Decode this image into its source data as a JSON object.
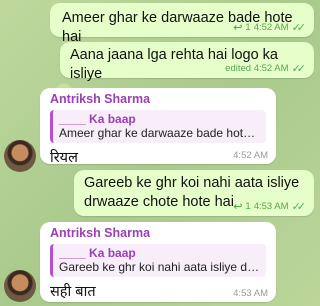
{
  "messages": [
    {
      "type": "out",
      "text": "Ameer ghar ke darwaaze bade hote hai",
      "reply_count": "1",
      "time": "4:52 AM"
    },
    {
      "type": "out",
      "text": "Aana jaana lga rehta hai logo ka isliye",
      "time": "edited 4:52 AM"
    },
    {
      "type": "in",
      "sender": "Antriksh Sharma",
      "quote_author": "____ Ka baap",
      "quote_text": "Ameer ghar ke darwaaze bade hote hai",
      "text": "रियल",
      "time": "4:52 AM"
    },
    {
      "type": "out",
      "text_line1": "Gareeb ke ghr koi nahi aata isliye",
      "text_line2": "drwaaze chote hote hai",
      "reply_count": "1",
      "time": "4:53 AM"
    },
    {
      "type": "in",
      "sender": "Antriksh Sharma",
      "quote_author": "____ Ka baap",
      "quote_text": "Gareeb ke ghr koi nahi aata isliye drwaa...",
      "text": "सही बात",
      "time": "4:53 AM"
    }
  ],
  "icons": {
    "reply": "reply-arrow-icon",
    "read": "double-check-icon"
  }
}
